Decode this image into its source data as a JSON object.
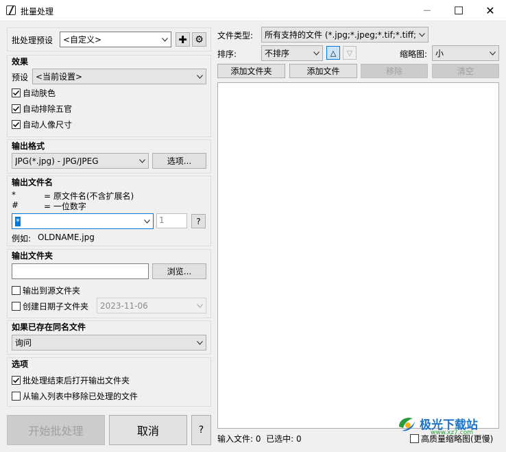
{
  "window": {
    "title": "批量处理",
    "minimize": "─",
    "maximize": "☐",
    "close": "✕"
  },
  "preset_row": {
    "label": "批处理预设",
    "value": "<自定义>",
    "add": "✚",
    "settings": "⚙"
  },
  "effects": {
    "title": "效果",
    "preset_label": "预设",
    "preset_value": "<当前设置>",
    "options": [
      {
        "label": "自动肤色",
        "checked": true
      },
      {
        "label": "自动排除五官",
        "checked": true
      },
      {
        "label": "自动人像尺寸",
        "checked": true
      }
    ]
  },
  "output_format": {
    "title": "输出格式",
    "value": "JPG(*.jpg) - JPG/JPEG",
    "options_button": "选项..."
  },
  "output_filename": {
    "title": "输出文件名",
    "legend": [
      {
        "sym": "*",
        "desc": "= 原文件名(不含扩展名)"
      },
      {
        "sym": "#",
        "desc": "= 一位数字"
      }
    ],
    "pattern": "*",
    "digits": "1",
    "help": "?",
    "example_label": "例如:",
    "example_value": "OLDNAME.jpg"
  },
  "output_folder": {
    "title": "输出文件夹",
    "path": "",
    "browse": "浏览...",
    "to_source": {
      "label": "输出到源文件夹",
      "checked": false
    },
    "date_subfolder": {
      "label": "创建日期子文件夹",
      "checked": false,
      "date": "2023-11-06"
    }
  },
  "conflict": {
    "title": "如果已存在同名文件",
    "value": "询问"
  },
  "options": {
    "title": "选项",
    "items": [
      {
        "label": "批处理结束后打开输出文件夹",
        "checked": true
      },
      {
        "label": "从输入列表中移除已处理的文件",
        "checked": false
      }
    ]
  },
  "actions": {
    "start": "开始批处理",
    "cancel": "取消",
    "help": "?"
  },
  "right": {
    "filetype_label": "文件类型:",
    "filetype_value": "所有支持的文件 (*.jpg;*.jpeg;*.tif;*.tiff;*.h",
    "sort_label": "排序:",
    "sort_value": "不排序",
    "sort_asc": "△",
    "sort_desc": "▽",
    "thumb_label": "缩略图:",
    "thumb_value": "小",
    "add_folder": "添加文件夹",
    "add_file": "添加文件",
    "remove": "移除",
    "clear": "清空",
    "status": "输入文件: 0  已选中: 0",
    "hq_thumbs": {
      "label": "高质量缩略图(更慢)",
      "checked": false
    }
  },
  "watermark": {
    "main": "极光下载站",
    "sub": "www.xz7.com"
  },
  "colors": {
    "accent": "#0078d7",
    "window_bg": "#f0f0f0",
    "watermark_green": "#2b9a3a",
    "watermark_blue": "#1a73c9"
  }
}
